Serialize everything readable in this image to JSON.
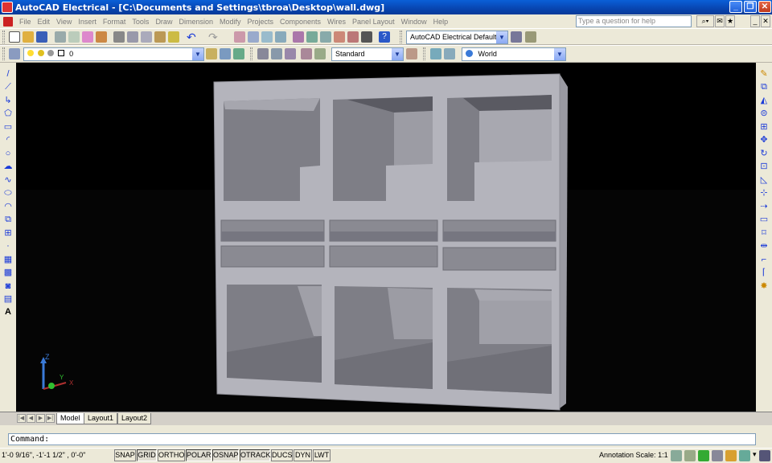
{
  "window": {
    "title": "AutoCAD Electrical - [C:\\Documents and Settings\\tbroa\\Desktop\\wall.dwg]",
    "minimize_label": "_",
    "restore_label": "❐",
    "close_label": "✕"
  },
  "menubar": {
    "items": [
      "File",
      "Edit",
      "View",
      "Insert",
      "Format",
      "Tools",
      "Draw",
      "Dimension",
      "Modify",
      "Projects",
      "Components",
      "Wires",
      "Panel Layout",
      "Window",
      "Help"
    ],
    "help_placeholder": "Type a question for help"
  },
  "toolbars": {
    "workspace": "AutoCAD Electrical Default",
    "layer": "0",
    "text_style": "Standard",
    "ucs": "World"
  },
  "viewport": {
    "background": "#000000",
    "wall_color": "#b8b8bf",
    "axis_labels": {
      "z": "Z",
      "y": "Y",
      "x": "X"
    }
  },
  "tabs": {
    "nav": [
      "|◀",
      "◀",
      "▶",
      "▶|"
    ],
    "items": [
      "Model",
      "Layout1",
      "Layout2"
    ],
    "active": "Model"
  },
  "command": {
    "prompt": "Command:"
  },
  "status": {
    "coords": "1'-0 9/16\",  -1'-1 1/2\" , 0'-0\"",
    "buttons": [
      "SNAP",
      "GRID",
      "ORTHO",
      "POLAR",
      "OSNAP",
      "OTRACK",
      "DUCS",
      "DYN",
      "LWT"
    ],
    "annotation_scale_label": "Annotation Scale:",
    "annotation_scale_value": "1:1"
  }
}
